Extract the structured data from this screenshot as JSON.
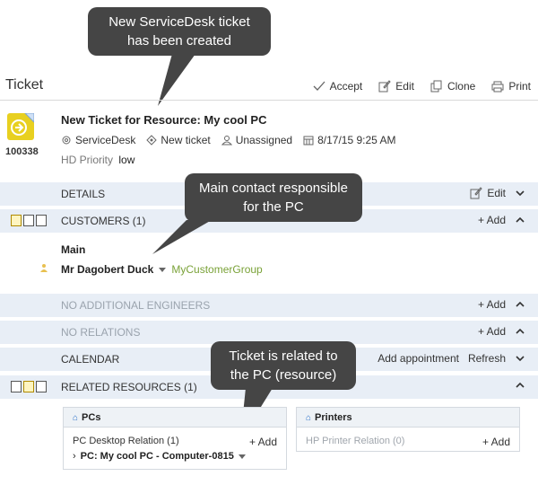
{
  "callouts": {
    "ticket_created": "New ServiceDesk ticket has been created",
    "main_contact": "Main contact responsible for the PC",
    "related": "Ticket is related to the PC (resource)"
  },
  "header": {
    "title": "Ticket",
    "actions": {
      "accept": "Accept",
      "edit": "Edit",
      "clone": "Clone",
      "print": "Print"
    }
  },
  "ticket": {
    "id": "100338",
    "title": "New Ticket for Resource: My cool PC",
    "module": "ServiceDesk",
    "status": "New ticket",
    "assignee": "Unassigned",
    "created": "8/17/15 9:25 AM",
    "priority_label": "HD Priority",
    "priority_value": "low"
  },
  "sections": {
    "details": {
      "title": "DETAILS",
      "action": "Edit"
    },
    "customers": {
      "title": "CUSTOMERS (1)",
      "action": "+ Add",
      "main_label": "Main",
      "customer_name": "Mr Dagobert Duck",
      "customer_group": "MyCustomerGroup"
    },
    "engineers": {
      "title": "NO ADDITIONAL ENGINEERS",
      "action": "+ Add"
    },
    "relations": {
      "title": "NO RELATIONS",
      "action": "+ Add"
    },
    "calendar": {
      "title": "CALENDAR",
      "add_appointment": "Add appointment",
      "refresh": "Refresh"
    },
    "resources": {
      "title": "RELATED RESOURCES (1)"
    }
  },
  "panels": {
    "pcs": {
      "header": "PCs",
      "relation": "PC Desktop Relation (1)",
      "add": "+ Add",
      "item": "PC: My cool PC - Computer-0815"
    },
    "printers": {
      "header": "Printers",
      "relation": "HP Printer Relation (0)",
      "add": "+ Add"
    }
  },
  "colors": {
    "section_bg": "#e8eef6",
    "callout_bg": "#454545",
    "group_green": "#7aa238",
    "icon_yellow": "#e8d020"
  }
}
